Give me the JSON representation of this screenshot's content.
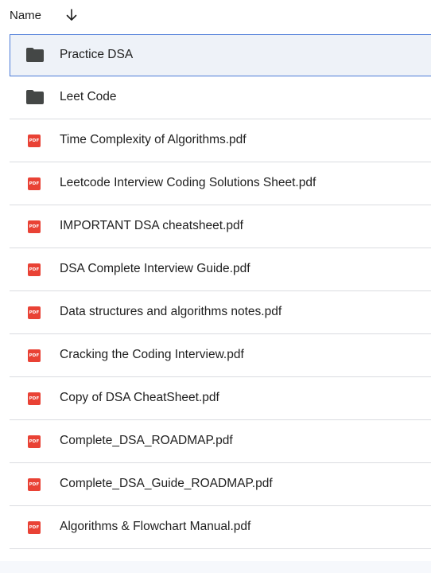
{
  "header": {
    "name_label": "Name",
    "sort_icon": "arrow-down-icon"
  },
  "colors": {
    "pdf_red": "#e94235",
    "folder_gray": "#444746",
    "selected_bg": "#eef2f8",
    "selected_border": "#4c7bd8",
    "divider": "#dadce0"
  },
  "files": [
    {
      "name": "Practice DSA",
      "type": "folder",
      "icon": "folder-icon",
      "selected": true
    },
    {
      "name": "Leet Code",
      "type": "folder",
      "icon": "folder-icon",
      "selected": false
    },
    {
      "name": "Time Complexity of Algorithms.pdf",
      "type": "pdf",
      "icon": "pdf-icon",
      "selected": false
    },
    {
      "name": "Leetcode Interview Coding Solutions Sheet.pdf",
      "type": "pdf",
      "icon": "pdf-icon",
      "selected": false
    },
    {
      "name": "IMPORTANT DSA cheatsheet.pdf",
      "type": "pdf",
      "icon": "pdf-icon",
      "selected": false
    },
    {
      "name": "DSA Complete Interview Guide.pdf",
      "type": "pdf",
      "icon": "pdf-icon",
      "selected": false
    },
    {
      "name": "Data structures and algorithms notes.pdf",
      "type": "pdf",
      "icon": "pdf-icon",
      "selected": false
    },
    {
      "name": "Cracking the Coding Interview.pdf",
      "type": "pdf",
      "icon": "pdf-icon",
      "selected": false
    },
    {
      "name": "Copy of DSA CheatSheet.pdf",
      "type": "pdf",
      "icon": "pdf-icon",
      "selected": false
    },
    {
      "name": "Complete_DSA_ROADMAP.pdf",
      "type": "pdf",
      "icon": "pdf-icon",
      "selected": false
    },
    {
      "name": "Complete_DSA_Guide_ROADMAP.pdf",
      "type": "pdf",
      "icon": "pdf-icon",
      "selected": false
    },
    {
      "name": "Algorithms & Flowchart Manual.pdf",
      "type": "pdf",
      "icon": "pdf-icon",
      "selected": false
    }
  ],
  "pdf_badge_text": "PDF"
}
